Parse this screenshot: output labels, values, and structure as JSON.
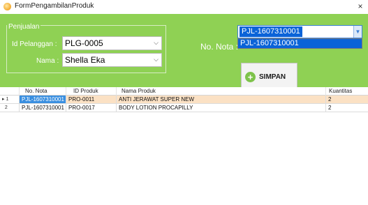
{
  "window": {
    "title": "FormPengambilanProduk",
    "close_label": "×"
  },
  "penjualan": {
    "group_label": "Penjualan",
    "id_pelanggan_label": "Id Pelanggan :",
    "id_pelanggan_value": "PLG-0005",
    "nama_label": "Nama :",
    "nama_value": "Shella Eka"
  },
  "nota": {
    "label": "No. Nota :",
    "value": "PJL-1607310001",
    "options": [
      "PJL-1607310001"
    ]
  },
  "simpan_button": {
    "label": "SIMPAN",
    "icon": "plus-icon"
  },
  "grid": {
    "columns": [
      "No. Nota",
      "ID Produk",
      "Nama Produk",
      "Kuantitas"
    ],
    "rows": [
      {
        "row_header": "1",
        "current": true,
        "no_nota": "PJL-1607310001",
        "id_produk": "PRO-0011",
        "nama_produk": "ANTI JERAWAT SUPER NEW",
        "kuantitas": "2"
      },
      {
        "row_header": "2",
        "current": false,
        "no_nota": "PJL-1607310001",
        "id_produk": "PRO-0017",
        "nama_produk": "BODY LOTION PROCAPILLY",
        "kuantitas": "2"
      }
    ]
  },
  "colors": {
    "panel": "#8fd154",
    "selection": "#0a63d8",
    "row_highlight": "#fbe1c4"
  }
}
